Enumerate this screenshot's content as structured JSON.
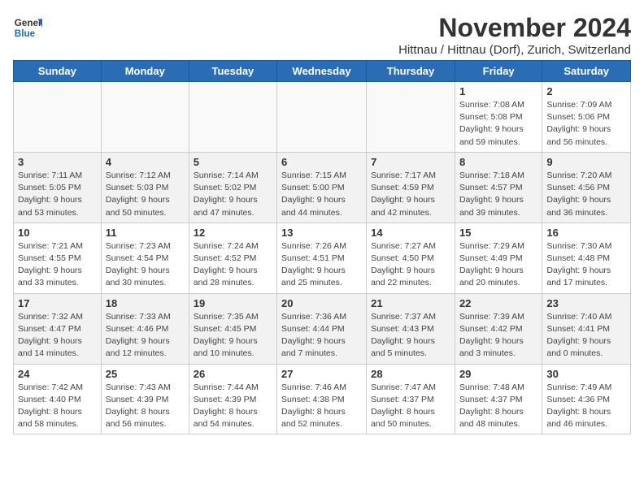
{
  "header": {
    "logo_general": "General",
    "logo_blue": "Blue",
    "title": "November 2024",
    "subtitle": "Hittnau / Hittnau (Dorf), Zurich, Switzerland"
  },
  "weekdays": [
    "Sunday",
    "Monday",
    "Tuesday",
    "Wednesday",
    "Thursday",
    "Friday",
    "Saturday"
  ],
  "weeks": [
    [
      {
        "day": "",
        "sunrise": "",
        "sunset": "",
        "daylight": "",
        "empty": true
      },
      {
        "day": "",
        "sunrise": "",
        "sunset": "",
        "daylight": "",
        "empty": true
      },
      {
        "day": "",
        "sunrise": "",
        "sunset": "",
        "daylight": "",
        "empty": true
      },
      {
        "day": "",
        "sunrise": "",
        "sunset": "",
        "daylight": "",
        "empty": true
      },
      {
        "day": "",
        "sunrise": "",
        "sunset": "",
        "daylight": "",
        "empty": true
      },
      {
        "day": "1",
        "sunrise": "Sunrise: 7:08 AM",
        "sunset": "Sunset: 5:08 PM",
        "daylight": "Daylight: 9 hours and 59 minutes.",
        "empty": false
      },
      {
        "day": "2",
        "sunrise": "Sunrise: 7:09 AM",
        "sunset": "Sunset: 5:06 PM",
        "daylight": "Daylight: 9 hours and 56 minutes.",
        "empty": false
      }
    ],
    [
      {
        "day": "3",
        "sunrise": "Sunrise: 7:11 AM",
        "sunset": "Sunset: 5:05 PM",
        "daylight": "Daylight: 9 hours and 53 minutes.",
        "empty": false
      },
      {
        "day": "4",
        "sunrise": "Sunrise: 7:12 AM",
        "sunset": "Sunset: 5:03 PM",
        "daylight": "Daylight: 9 hours and 50 minutes.",
        "empty": false
      },
      {
        "day": "5",
        "sunrise": "Sunrise: 7:14 AM",
        "sunset": "Sunset: 5:02 PM",
        "daylight": "Daylight: 9 hours and 47 minutes.",
        "empty": false
      },
      {
        "day": "6",
        "sunrise": "Sunrise: 7:15 AM",
        "sunset": "Sunset: 5:00 PM",
        "daylight": "Daylight: 9 hours and 44 minutes.",
        "empty": false
      },
      {
        "day": "7",
        "sunrise": "Sunrise: 7:17 AM",
        "sunset": "Sunset: 4:59 PM",
        "daylight": "Daylight: 9 hours and 42 minutes.",
        "empty": false
      },
      {
        "day": "8",
        "sunrise": "Sunrise: 7:18 AM",
        "sunset": "Sunset: 4:57 PM",
        "daylight": "Daylight: 9 hours and 39 minutes.",
        "empty": false
      },
      {
        "day": "9",
        "sunrise": "Sunrise: 7:20 AM",
        "sunset": "Sunset: 4:56 PM",
        "daylight": "Daylight: 9 hours and 36 minutes.",
        "empty": false
      }
    ],
    [
      {
        "day": "10",
        "sunrise": "Sunrise: 7:21 AM",
        "sunset": "Sunset: 4:55 PM",
        "daylight": "Daylight: 9 hours and 33 minutes.",
        "empty": false
      },
      {
        "day": "11",
        "sunrise": "Sunrise: 7:23 AM",
        "sunset": "Sunset: 4:54 PM",
        "daylight": "Daylight: 9 hours and 30 minutes.",
        "empty": false
      },
      {
        "day": "12",
        "sunrise": "Sunrise: 7:24 AM",
        "sunset": "Sunset: 4:52 PM",
        "daylight": "Daylight: 9 hours and 28 minutes.",
        "empty": false
      },
      {
        "day": "13",
        "sunrise": "Sunrise: 7:26 AM",
        "sunset": "Sunset: 4:51 PM",
        "daylight": "Daylight: 9 hours and 25 minutes.",
        "empty": false
      },
      {
        "day": "14",
        "sunrise": "Sunrise: 7:27 AM",
        "sunset": "Sunset: 4:50 PM",
        "daylight": "Daylight: 9 hours and 22 minutes.",
        "empty": false
      },
      {
        "day": "15",
        "sunrise": "Sunrise: 7:29 AM",
        "sunset": "Sunset: 4:49 PM",
        "daylight": "Daylight: 9 hours and 20 minutes.",
        "empty": false
      },
      {
        "day": "16",
        "sunrise": "Sunrise: 7:30 AM",
        "sunset": "Sunset: 4:48 PM",
        "daylight": "Daylight: 9 hours and 17 minutes.",
        "empty": false
      }
    ],
    [
      {
        "day": "17",
        "sunrise": "Sunrise: 7:32 AM",
        "sunset": "Sunset: 4:47 PM",
        "daylight": "Daylight: 9 hours and 14 minutes.",
        "empty": false
      },
      {
        "day": "18",
        "sunrise": "Sunrise: 7:33 AM",
        "sunset": "Sunset: 4:46 PM",
        "daylight": "Daylight: 9 hours and 12 minutes.",
        "empty": false
      },
      {
        "day": "19",
        "sunrise": "Sunrise: 7:35 AM",
        "sunset": "Sunset: 4:45 PM",
        "daylight": "Daylight: 9 hours and 10 minutes.",
        "empty": false
      },
      {
        "day": "20",
        "sunrise": "Sunrise: 7:36 AM",
        "sunset": "Sunset: 4:44 PM",
        "daylight": "Daylight: 9 hours and 7 minutes.",
        "empty": false
      },
      {
        "day": "21",
        "sunrise": "Sunrise: 7:37 AM",
        "sunset": "Sunset: 4:43 PM",
        "daylight": "Daylight: 9 hours and 5 minutes.",
        "empty": false
      },
      {
        "day": "22",
        "sunrise": "Sunrise: 7:39 AM",
        "sunset": "Sunset: 4:42 PM",
        "daylight": "Daylight: 9 hours and 3 minutes.",
        "empty": false
      },
      {
        "day": "23",
        "sunrise": "Sunrise: 7:40 AM",
        "sunset": "Sunset: 4:41 PM",
        "daylight": "Daylight: 9 hours and 0 minutes.",
        "empty": false
      }
    ],
    [
      {
        "day": "24",
        "sunrise": "Sunrise: 7:42 AM",
        "sunset": "Sunset: 4:40 PM",
        "daylight": "Daylight: 8 hours and 58 minutes.",
        "empty": false
      },
      {
        "day": "25",
        "sunrise": "Sunrise: 7:43 AM",
        "sunset": "Sunset: 4:39 PM",
        "daylight": "Daylight: 8 hours and 56 minutes.",
        "empty": false
      },
      {
        "day": "26",
        "sunrise": "Sunrise: 7:44 AM",
        "sunset": "Sunset: 4:39 PM",
        "daylight": "Daylight: 8 hours and 54 minutes.",
        "empty": false
      },
      {
        "day": "27",
        "sunrise": "Sunrise: 7:46 AM",
        "sunset": "Sunset: 4:38 PM",
        "daylight": "Daylight: 8 hours and 52 minutes.",
        "empty": false
      },
      {
        "day": "28",
        "sunrise": "Sunrise: 7:47 AM",
        "sunset": "Sunset: 4:37 PM",
        "daylight": "Daylight: 8 hours and 50 minutes.",
        "empty": false
      },
      {
        "day": "29",
        "sunrise": "Sunrise: 7:48 AM",
        "sunset": "Sunset: 4:37 PM",
        "daylight": "Daylight: 8 hours and 48 minutes.",
        "empty": false
      },
      {
        "day": "30",
        "sunrise": "Sunrise: 7:49 AM",
        "sunset": "Sunset: 4:36 PM",
        "daylight": "Daylight: 8 hours and 46 minutes.",
        "empty": false
      }
    ]
  ],
  "row_shading": [
    false,
    true,
    false,
    true,
    false
  ]
}
